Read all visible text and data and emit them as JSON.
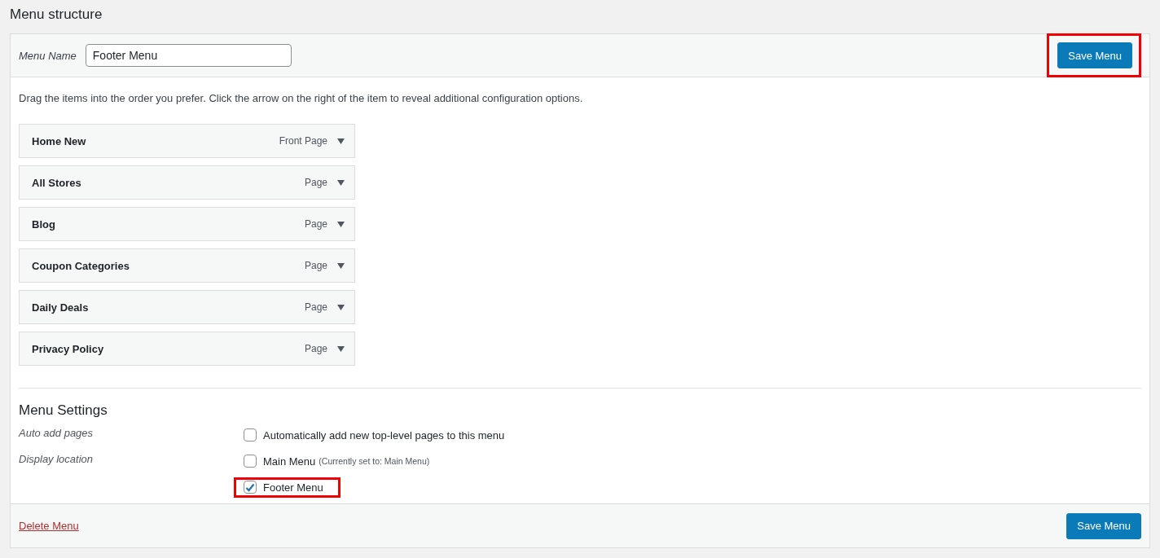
{
  "page_title": "Menu structure",
  "header": {
    "menu_name_label": "Menu Name",
    "menu_name_value": "Footer Menu",
    "save_button": {
      "label": "Save Menu",
      "highlighted": true
    }
  },
  "instructions": "Drag the items into the order you prefer. Click the arrow on the right of the item to reveal additional configuration options.",
  "menu_items": [
    {
      "title": "Home New",
      "type": "Front Page"
    },
    {
      "title": "All Stores",
      "type": "Page"
    },
    {
      "title": "Blog",
      "type": "Page"
    },
    {
      "title": "Coupon Categories",
      "type": "Page"
    },
    {
      "title": "Daily Deals",
      "type": "Page"
    },
    {
      "title": "Privacy Policy",
      "type": "Page"
    }
  ],
  "settings": {
    "heading": "Menu Settings",
    "rows": [
      {
        "label": "Auto add pages",
        "options": [
          {
            "label": "Automatically add new top-level pages to this menu",
            "checked": false,
            "highlighted": false
          }
        ]
      },
      {
        "label": "Display location",
        "options": [
          {
            "label": "Main Menu",
            "note": "(Currently set to: Main Menu)",
            "checked": false,
            "highlighted": false
          },
          {
            "label": "Footer Menu",
            "checked": true,
            "highlighted": true
          }
        ]
      }
    ]
  },
  "footer": {
    "delete_link": "Delete Menu",
    "save_button": {
      "label": "Save Menu",
      "highlighted": false
    }
  }
}
